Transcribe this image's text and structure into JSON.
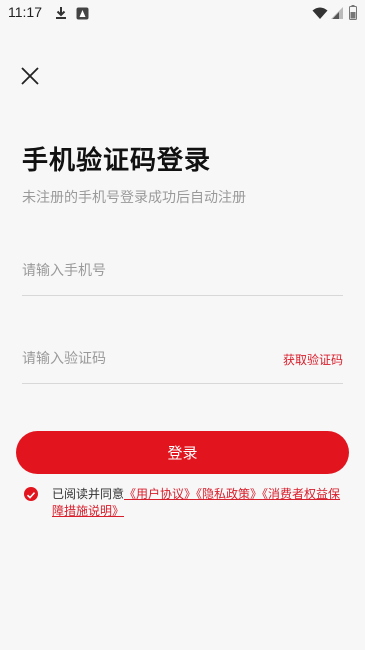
{
  "status_bar": {
    "time": "11:17"
  },
  "page": {
    "title": "手机验证码登录",
    "subtitle": "未注册的手机号登录成功后自动注册"
  },
  "phone_field": {
    "placeholder": "请输入手机号"
  },
  "code_field": {
    "placeholder": "请输入验证码",
    "get_code_label": "获取验证码"
  },
  "login_button": {
    "label": "登录"
  },
  "agreement": {
    "prefix": "已阅读并同意",
    "user_agreement": "《用户协议》",
    "privacy_policy": "《隐私政策》",
    "consumer_rights": "《消费者权益保障措施说明》"
  },
  "colors": {
    "accent": "#e2151f",
    "link": "#d81e2b",
    "background": "#f7f7f7"
  }
}
